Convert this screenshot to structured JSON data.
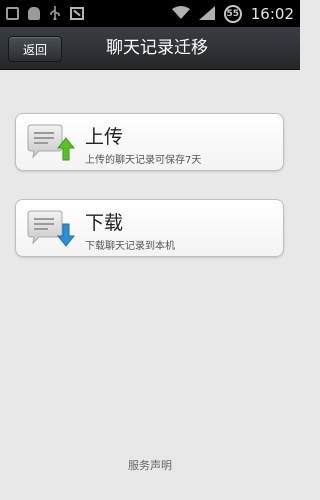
{
  "status_bar": {
    "time": "16:02",
    "battery": "55",
    "icons": [
      "message-icon",
      "android-icon",
      "usb-icon",
      "image-icon",
      "wifi-icon",
      "signal-icon",
      "battery-icon"
    ]
  },
  "header": {
    "back_label": "返回",
    "title": "聊天记录迁移"
  },
  "options": [
    {
      "title": "上传",
      "description": "上传的聊天记录可保存7天",
      "icon": "upload-chat-icon",
      "arrow_color": "#5bbf2a"
    },
    {
      "title": "下载",
      "description": "下载聊天记录到本机",
      "icon": "download-chat-icon",
      "arrow_color": "#2a8fd6"
    }
  ],
  "footer": {
    "service_label": "服务声明"
  }
}
